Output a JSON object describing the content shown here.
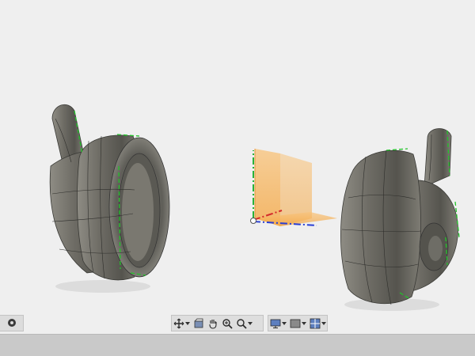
{
  "colors": {
    "background": "#efefef",
    "model_body": "#6b6a64",
    "edge_highlight": "#22c32a",
    "plane_orange": "#f6a83c",
    "axis_x": "#d42b2b",
    "axis_y": "#28b33a",
    "axis_z": "#2a3fd4"
  },
  "icons": {
    "nav": [
      "orbit-icon",
      "look-at-icon",
      "pan-icon",
      "zoom-icon",
      "zoom-window-icon"
    ],
    "display": [
      "display-settings-icon",
      "visual-style-icon",
      "grid-icon"
    ]
  }
}
